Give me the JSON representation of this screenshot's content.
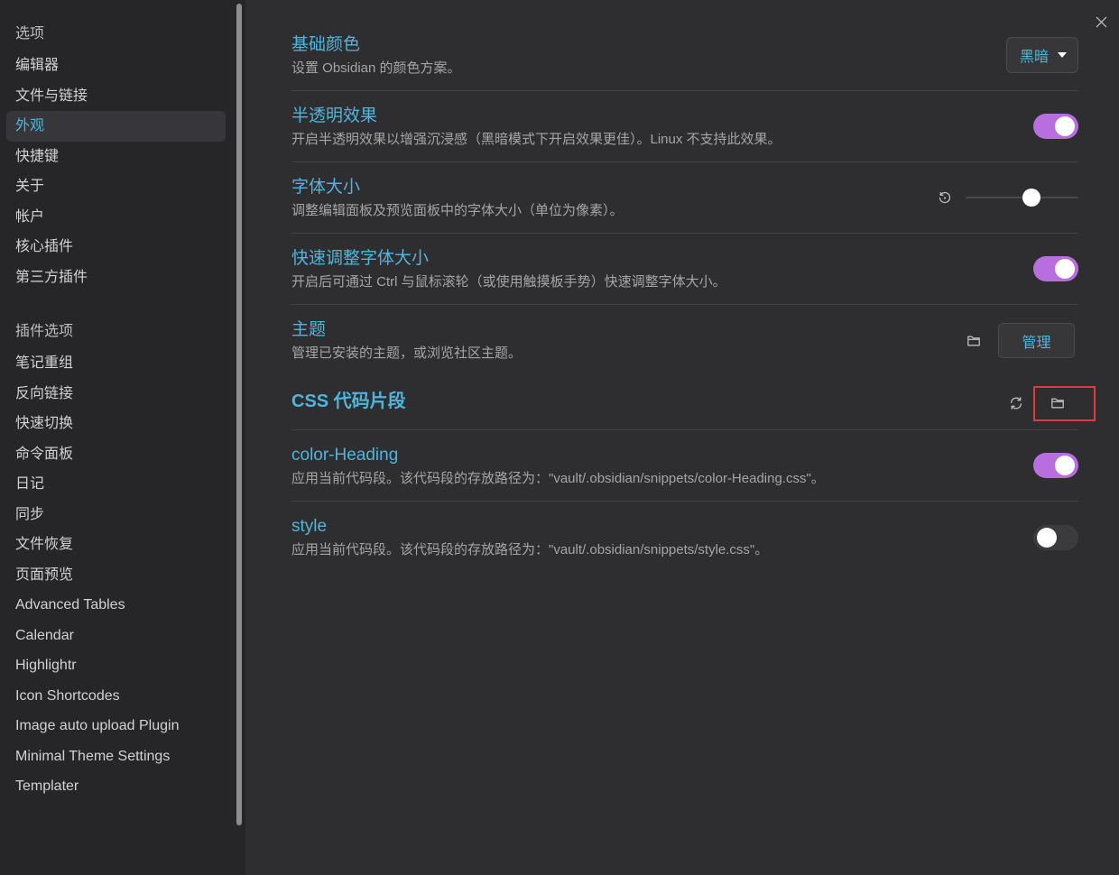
{
  "colors": {
    "sidebar_bg": "#262629",
    "main_bg": "#2e2e31",
    "accent": "#50b5da",
    "toggle_on": "#b96ee0",
    "toggle_off": "#3b3b3e",
    "text": "#d2d2d2",
    "muted": "#a5a5a5",
    "highlight_box": "#e03a3a"
  },
  "window": {
    "close_icon": "close-icon"
  },
  "sidebar": {
    "options": {
      "header": "选项",
      "items": [
        {
          "label": "编辑器"
        },
        {
          "label": "文件与链接"
        },
        {
          "label": "外观",
          "selected": true
        },
        {
          "label": "快捷键"
        },
        {
          "label": "关于"
        },
        {
          "label": "帐户"
        },
        {
          "label": "核心插件"
        },
        {
          "label": "第三方插件"
        }
      ]
    },
    "plugin_options": {
      "header": "插件选项",
      "items": [
        {
          "label": "笔记重组"
        },
        {
          "label": "反向链接"
        },
        {
          "label": "快速切换"
        },
        {
          "label": "命令面板"
        },
        {
          "label": "日记"
        },
        {
          "label": "同步"
        },
        {
          "label": "文件恢复"
        },
        {
          "label": "页面预览"
        },
        {
          "label": "Advanced Tables"
        },
        {
          "label": "Calendar"
        },
        {
          "label": "Highlightr"
        },
        {
          "label": "Icon Shortcodes"
        },
        {
          "label": "Image auto upload Plugin"
        },
        {
          "label": "Minimal Theme Settings"
        },
        {
          "label": "Templater"
        }
      ]
    }
  },
  "settings": {
    "base_color": {
      "title": "基础颜色",
      "description": "设置 Obsidian 的颜色方案。",
      "value": "黑暗",
      "icon": "caret-down-icon"
    },
    "translucency": {
      "title": "半透明效果",
      "description": "开启半透明效果以增强沉浸感（黑暗模式下开启效果更佳）。Linux 不支持此效果。",
      "enabled": true
    },
    "font_size": {
      "title": "字体大小",
      "description": "调整编辑面板及预览面板中的字体大小（单位为像素）。",
      "slider_level": 0.58,
      "reset_icon": "reset-icon"
    },
    "quick_font_size": {
      "title": "快速调整字体大小",
      "description": "开启后可通过 Ctrl 与鼠标滚轮（或使用触摸板手势）快速调整字体大小。",
      "enabled": true
    },
    "themes": {
      "title": "主题",
      "description": "管理已安装的主题，或浏览社区主题。",
      "manage_label": "管理",
      "folder_icon": "folder-icon"
    },
    "css_snippets": {
      "heading": "CSS 代码片段",
      "reload_icon": "reload-icon",
      "folder_icon": "folder-icon",
      "folder_highlighted": true
    },
    "snippets": [
      {
        "title": "color-Heading",
        "description": "应用当前代码段。该代码段的存放路径为：\"vault/.obsidian/snippets/color-Heading.css\"。",
        "enabled": true
      },
      {
        "title": "style",
        "description": "应用当前代码段。该代码段的存放路径为：\"vault/.obsidian/snippets/style.css\"。",
        "enabled": false
      }
    ]
  }
}
